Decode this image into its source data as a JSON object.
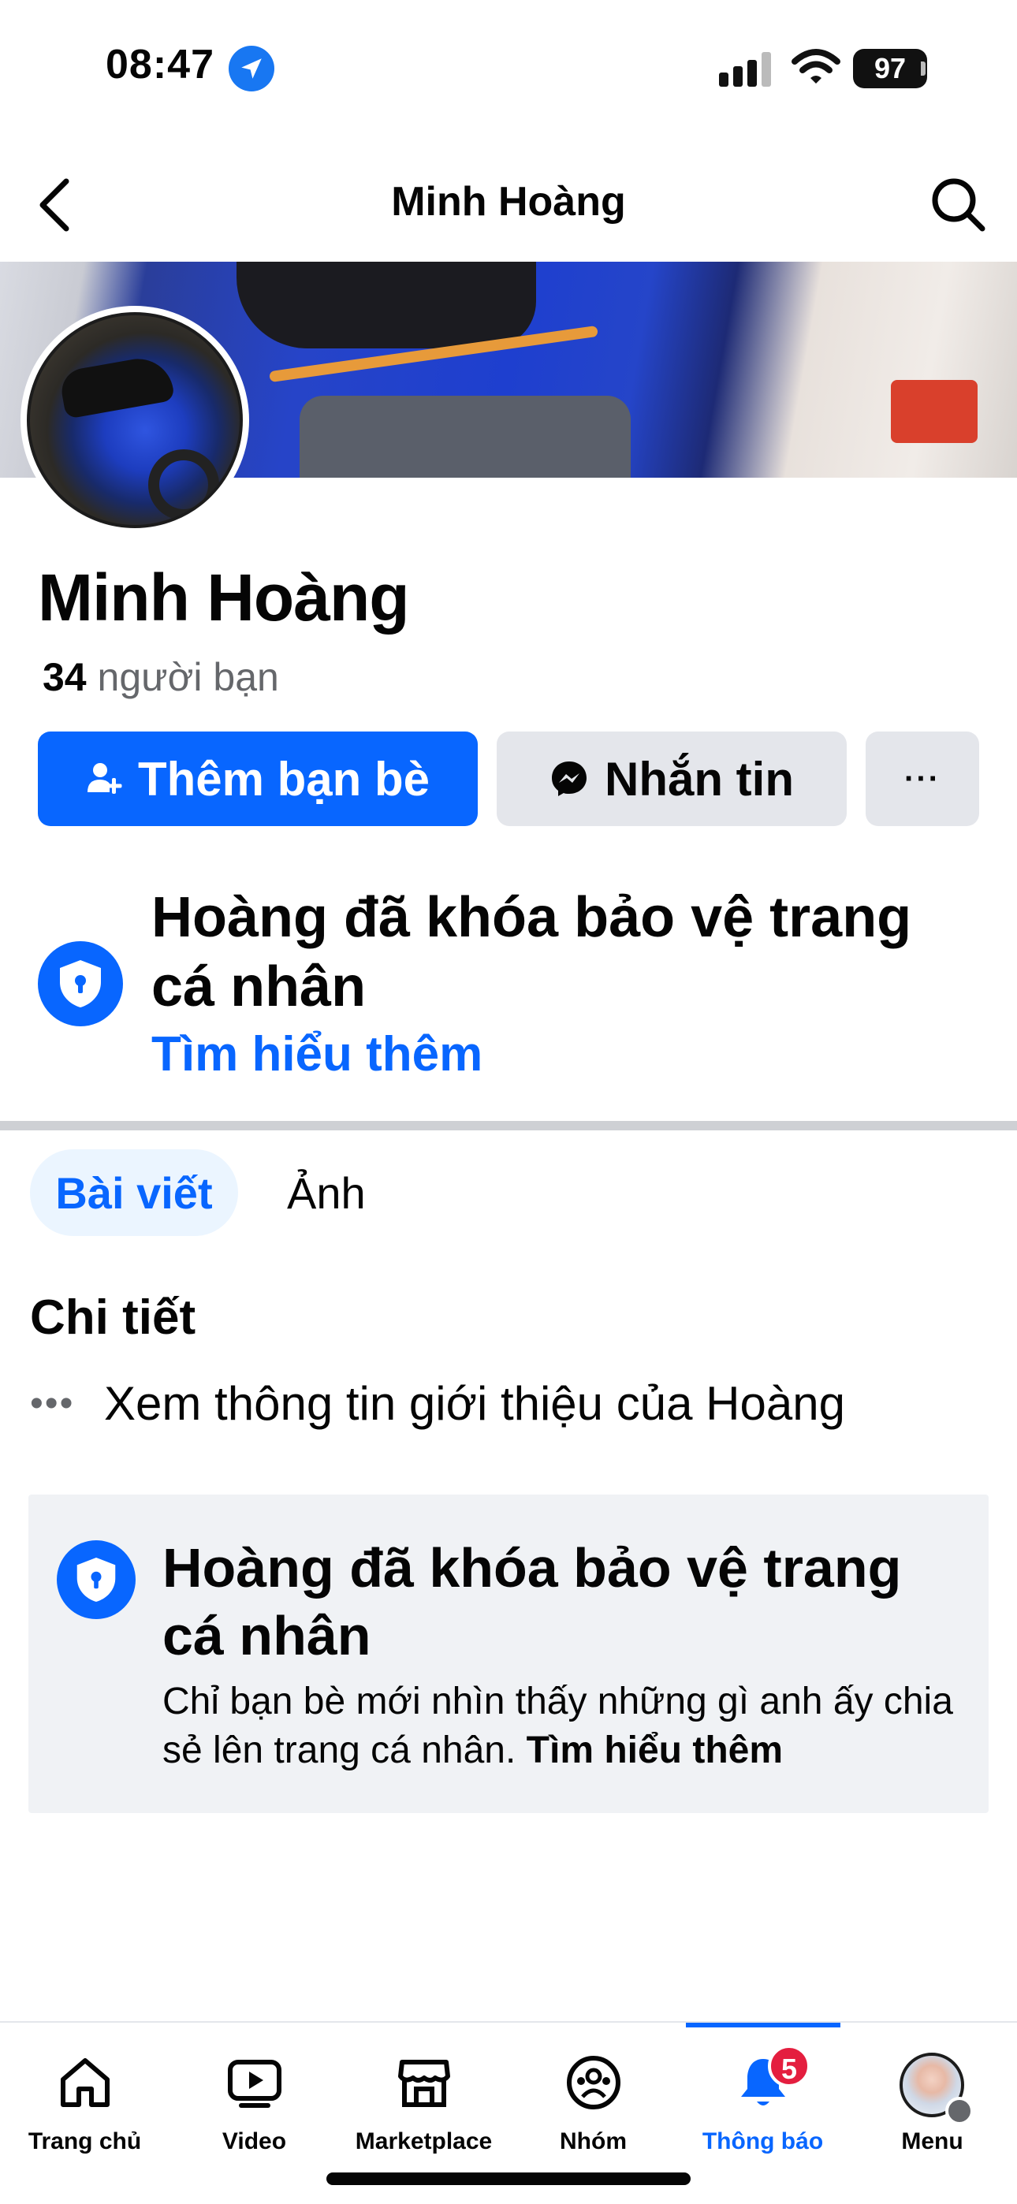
{
  "status_bar": {
    "time": "08:47",
    "battery": "97"
  },
  "header": {
    "title": "Minh Hoàng"
  },
  "profile": {
    "name": "Minh Hoàng",
    "friend_count": "34",
    "friend_label": "người bạn"
  },
  "actions": {
    "add_friend": "Thêm bạn bè",
    "message": "Nhắn tin",
    "more": "···"
  },
  "locked_notice": {
    "title": "Hoàng đã khóa bảo vệ trang cá nhân",
    "link": "Tìm hiểu thêm"
  },
  "tabs": [
    {
      "label": "Bài viết",
      "active": true
    },
    {
      "label": "Ảnh",
      "active": false
    }
  ],
  "details": {
    "title": "Chi tiết",
    "item_icon": "more-dots-icon",
    "item_text": "Xem thông tin giới thiệu của Hoàng"
  },
  "info_card": {
    "title": "Hoàng đã khóa bảo vệ trang cá nhân",
    "description": "Chỉ bạn bè mới nhìn thấy những gì anh ấy chia sẻ lên trang cá nhân.",
    "link": "Tìm hiểu thêm"
  },
  "bottom_nav": {
    "items": [
      {
        "label": "Trang chủ",
        "icon": "home-icon"
      },
      {
        "label": "Video",
        "icon": "video-icon"
      },
      {
        "label": "Marketplace",
        "icon": "marketplace-icon"
      },
      {
        "label": "Nhóm",
        "icon": "groups-icon"
      },
      {
        "label": "Thông báo",
        "icon": "bell-icon",
        "active": true,
        "badge": "5"
      },
      {
        "label": "Menu",
        "icon": "profile-avatar-icon"
      }
    ]
  },
  "colors": {
    "accent": "#0866ff",
    "badge": "#e41e3f",
    "secondary_button": "#e4e6eb",
    "card_bg": "#f0f2f5"
  }
}
